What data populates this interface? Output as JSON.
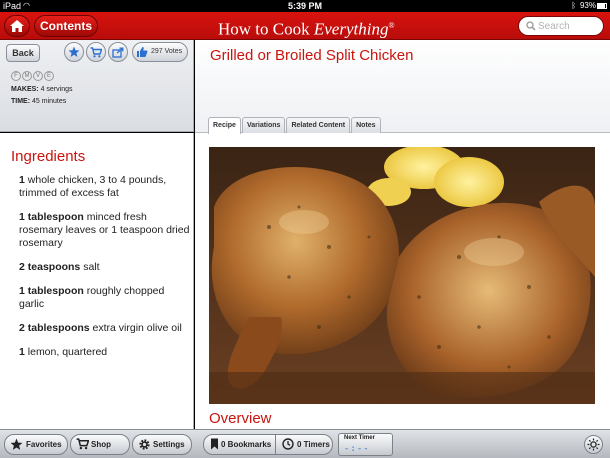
{
  "status_bar": {
    "carrier": "iPad",
    "time": "5:39 PM",
    "battery": "93%"
  },
  "header": {
    "contents_label": "Contents",
    "title_plain": "How to Cook ",
    "title_italic": "Everything",
    "title_mark": "®",
    "search_placeholder": "Search"
  },
  "left_panel": {
    "back_label": "Back",
    "votes_label": "297 Votes",
    "badges": [
      "F",
      "M",
      "V",
      "E"
    ],
    "makes_label": "MAKES:",
    "makes_value": "4 servings",
    "time_label": "TIME:",
    "time_value": "45 minutes",
    "ingredients_title": "Ingredients",
    "ingredients": [
      {
        "qty": "1",
        "unit": "",
        "text": "whole chicken, 3 to 4 pounds, trimmed of excess fat"
      },
      {
        "qty": "1",
        "unit": "tablespoon",
        "text": "minced fresh rosemary leaves or 1 teaspoon dried rosemary"
      },
      {
        "qty": "2",
        "unit": "teaspoons",
        "text": "salt"
      },
      {
        "qty": "1",
        "unit": "tablespoon",
        "text": "roughly chopped garlic"
      },
      {
        "qty": "2",
        "unit": "tablespoons",
        "text": "extra virgin olive oil"
      },
      {
        "qty": "1",
        "unit": "",
        "text": "lemon, quartered"
      }
    ]
  },
  "recipe": {
    "title": "Grilled or Broiled Split Chicken",
    "tabs": [
      "Recipe",
      "Variations",
      "Related Content",
      "Notes"
    ],
    "active_tab": "Recipe",
    "overview_title": "Overview"
  },
  "bottom_bar": {
    "favorites": "Favorites",
    "shop": "Shop",
    "settings": "Settings",
    "bookmarks": "0 Bookmarks",
    "timers": "0 Timers",
    "next_timer_label": "Next Timer",
    "next_timer_value": "-:--"
  },
  "colors": {
    "brand_red": "#c8150f",
    "header_red": "#d8130f",
    "accent_blue": "#2b6fd0"
  }
}
